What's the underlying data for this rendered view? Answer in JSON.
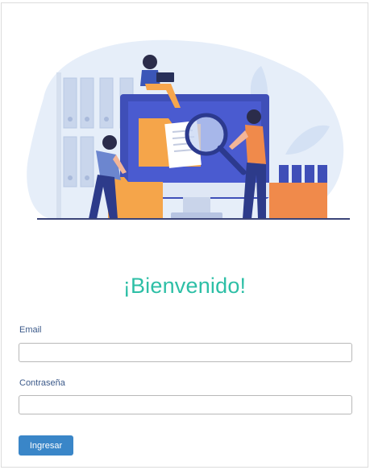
{
  "login": {
    "title": "¡Bienvenido!",
    "email_label": "Email",
    "email_value": "",
    "password_label": "Contraseña",
    "password_value": "",
    "submit_label": "Ingresar"
  },
  "colors": {
    "title": "#2dbfa6",
    "button": "#3a86c8",
    "label": "#3c5a8a"
  },
  "illustration": {
    "icon": "file-search-illustration"
  }
}
